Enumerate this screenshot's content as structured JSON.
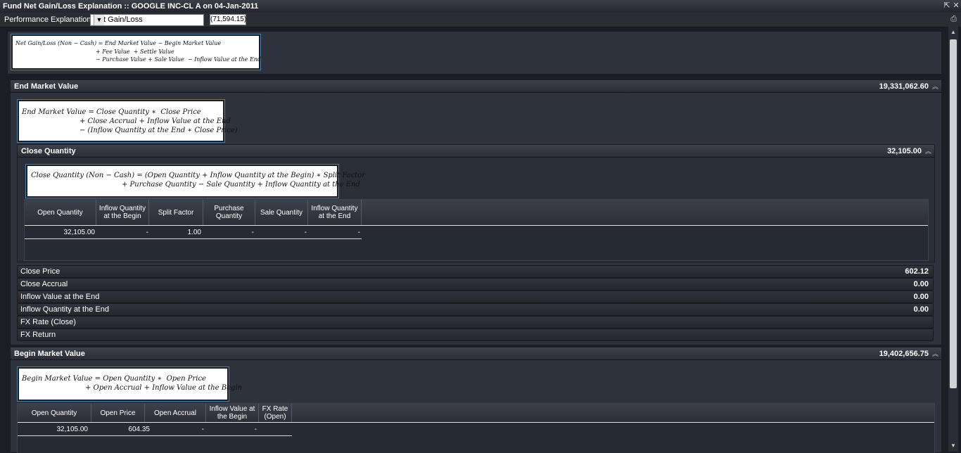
{
  "window": {
    "title": "Fund Net Gain/Loss Explanation :: GOOGLE INC-CL A on 04-Jan-2011",
    "restore_icon": "restore-icon",
    "close_icon": "close-icon"
  },
  "perf": {
    "label": "Performance Explanation:",
    "selected": "Net Gain/Loss",
    "value": "(71,594.15)"
  },
  "top_formula": {
    "lines": [
      "Net Gain/Loss (Non − Cash) = End Market Value − Begin Market Value",
      "+ Fee Value  + Settle Value",
      "− Purchase Value + Sale Value  − Inflow Value at the End"
    ]
  },
  "end_market": {
    "title": "End Market Value",
    "value": "19,331,062.60",
    "formula": [
      "End Market Value = Close Quantity ∗  Close Price",
      "+ Close Accrual + Inflow Value at the End",
      "− (Inflow Quantity at the End ∗ Close Price)"
    ],
    "close_quantity": {
      "title": "Close Quantity",
      "value": "32,105.00",
      "formula": [
        "Close Quantity (Non − Cash) = (Open Quantity + Inflow Quantity at the Begin) ∗ Split Factor",
        "+ Purchase Quantity − Sale Quantity + Inflow Quantity at the End"
      ],
      "columns": [
        "Open Quantity",
        "Inflow Quantity at the Begin",
        "Split Factor",
        "Purchase Quantity",
        "Sale Quantity",
        "Inflow Quantity at the End"
      ],
      "row": [
        "32,105.00",
        "-",
        "1.00",
        "-",
        "-",
        "-"
      ]
    },
    "rows": [
      {
        "label": "Close Price",
        "value": "602.12"
      },
      {
        "label": "Close Accrual",
        "value": "0.00"
      },
      {
        "label": "Inflow Value at the End",
        "value": "0.00"
      },
      {
        "label": "Inflow Quantity at the End",
        "value": "0.00"
      },
      {
        "label": "FX Rate (Close)",
        "value": ""
      },
      {
        "label": "FX Return",
        "value": ""
      }
    ]
  },
  "begin_market": {
    "title": "Begin Market Value",
    "value": "19,402,656.75",
    "formula": [
      "Begin Market Value = Open Quantity ∗  Open Price",
      "+ Open Accrual + Inflow Value at the Begin"
    ],
    "columns": [
      "Open Quantity",
      "Open Price",
      "Open Accrual",
      "Inflow Value at the Begin",
      "FX Rate (Open)"
    ],
    "row": [
      "32,105.00",
      "604.35",
      "-",
      "-",
      ""
    ]
  }
}
